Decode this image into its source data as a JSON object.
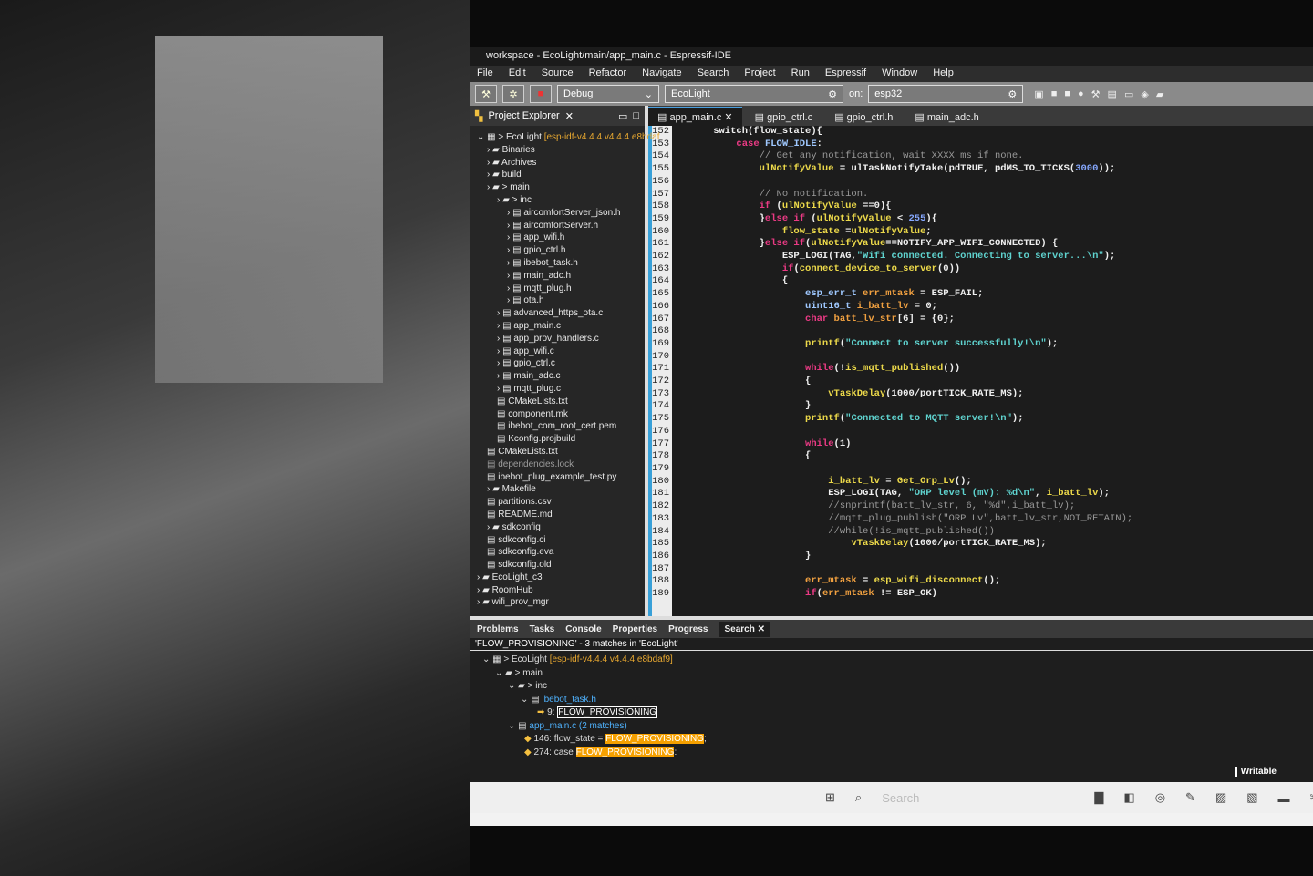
{
  "window": {
    "title": "workspace - EcoLight/main/app_main.c - Espressif-IDE"
  },
  "menu": [
    "File",
    "Edit",
    "Source",
    "Refactor",
    "Navigate",
    "Search",
    "Project",
    "Run",
    "Espressif",
    "Window",
    "Help"
  ],
  "toolbar": {
    "mode": "Debug",
    "project": "EcoLight",
    "on_label": "on:",
    "target": "esp32"
  },
  "explorer": {
    "title": "Project Explorer",
    "root": "> EcoLight",
    "root_version": "[esp-idf-v4.4.4 v4.4.4 e8bdaf",
    "items": [
      {
        "label": "Binaries",
        "indent": 1
      },
      {
        "label": "Archives",
        "indent": 1
      },
      {
        "label": "build",
        "indent": 1
      },
      {
        "label": "> main",
        "indent": 1
      },
      {
        "label": "> inc",
        "indent": 2
      },
      {
        "label": "aircomfortServer_json.h",
        "indent": 3
      },
      {
        "label": "aircomfortServer.h",
        "indent": 3
      },
      {
        "label": "app_wifi.h",
        "indent": 3
      },
      {
        "label": "gpio_ctrl.h",
        "indent": 3
      },
      {
        "label": "ibebot_task.h",
        "indent": 3
      },
      {
        "label": "main_adc.h",
        "indent": 3
      },
      {
        "label": "mqtt_plug.h",
        "indent": 3
      },
      {
        "label": "ota.h",
        "indent": 3
      },
      {
        "label": "advanced_https_ota.c",
        "indent": 2
      },
      {
        "label": "app_main.c",
        "indent": 2
      },
      {
        "label": "app_prov_handlers.c",
        "indent": 2
      },
      {
        "label": "app_wifi.c",
        "indent": 2
      },
      {
        "label": "gpio_ctrl.c",
        "indent": 2
      },
      {
        "label": "main_adc.c",
        "indent": 2
      },
      {
        "label": "mqtt_plug.c",
        "indent": 2
      },
      {
        "label": "CMakeLists.txt",
        "indent": 2
      },
      {
        "label": "component.mk",
        "indent": 2
      },
      {
        "label": "ibebot_com_root_cert.pem",
        "indent": 2
      },
      {
        "label": "Kconfig.projbuild",
        "indent": 2
      },
      {
        "label": "CMakeLists.txt",
        "indent": 1
      },
      {
        "label": "dependencies.lock",
        "indent": 1,
        "dim": true
      },
      {
        "label": "ibebot_plug_example_test.py",
        "indent": 1
      },
      {
        "label": "Makefile",
        "indent": 1
      },
      {
        "label": "partitions.csv",
        "indent": 1
      },
      {
        "label": "README.md",
        "indent": 1
      },
      {
        "label": "sdkconfig",
        "indent": 1
      },
      {
        "label": "sdkconfig.ci",
        "indent": 1
      },
      {
        "label": "sdkconfig.eva",
        "indent": 1
      },
      {
        "label": "sdkconfig.old",
        "indent": 1
      },
      {
        "label": "EcoLight_c3",
        "indent": 0
      },
      {
        "label": "RoomHub",
        "indent": 0
      },
      {
        "label": "wifi_prov_mgr",
        "indent": 0
      }
    ]
  },
  "editor": {
    "tabs": [
      "app_main.c",
      "gpio_ctrl.c",
      "gpio_ctrl.h",
      "main_adc.h"
    ],
    "active_tab": 0,
    "first_line": 152,
    "lines": [
      [
        [
          "    switch(flow_state){",
          "p"
        ]
      ],
      [
        [
          "        ",
          "p"
        ],
        [
          "case ",
          "k"
        ],
        [
          "FLOW_IDLE",
          "m"
        ],
        [
          ":",
          "p"
        ]
      ],
      [
        [
          "            // Get any notification, wait XXXX ms if none.",
          "c"
        ]
      ],
      [
        [
          "            ",
          "p"
        ],
        [
          "ulNotifyValue",
          "i"
        ],
        [
          " = ulTaskNotifyTake(pdTRUE, pdMS_TO_TICKS(",
          "p"
        ],
        [
          "3000",
          "n"
        ],
        [
          "));",
          "p"
        ]
      ],
      [
        [
          "",
          "p"
        ]
      ],
      [
        [
          "            // No notification.",
          "c"
        ]
      ],
      [
        [
          "            ",
          "p"
        ],
        [
          "if ",
          "k"
        ],
        [
          "(",
          "p"
        ],
        [
          "ulNotifyValue",
          "i"
        ],
        [
          " ==0){",
          "p"
        ]
      ],
      [
        [
          "            }",
          "p"
        ],
        [
          "else if ",
          "k"
        ],
        [
          "(",
          "p"
        ],
        [
          "ulNotifyValue",
          "i"
        ],
        [
          " < ",
          "p"
        ],
        [
          "255",
          "n"
        ],
        [
          "){",
          "p"
        ]
      ],
      [
        [
          "                ",
          "p"
        ],
        [
          "flow_state",
          "i"
        ],
        [
          " =",
          "p"
        ],
        [
          "ulNotifyValue",
          "i"
        ],
        [
          ";",
          "p"
        ]
      ],
      [
        [
          "            }",
          "p"
        ],
        [
          "else if",
          "k"
        ],
        [
          "(",
          "p"
        ],
        [
          "ulNotifyValue",
          "i"
        ],
        [
          "==NOTIFY_APP_WIFI_CONNECTED) {",
          "p"
        ]
      ],
      [
        [
          "                ESP_LOGI(TAG,",
          "p"
        ],
        [
          "\"Wifi connected. Connecting to server...\\n\"",
          "s"
        ],
        [
          ");",
          "p"
        ]
      ],
      [
        [
          "                ",
          "p"
        ],
        [
          "if",
          "k"
        ],
        [
          "(",
          "p"
        ],
        [
          "connect_device_to_server",
          "i"
        ],
        [
          "(0))",
          "p"
        ]
      ],
      [
        [
          "                {",
          "p"
        ]
      ],
      [
        [
          "                    ",
          "p"
        ],
        [
          "esp_err_t ",
          "m"
        ],
        [
          "err_mtask",
          "e"
        ],
        [
          " = ESP_FAIL;",
          "p"
        ]
      ],
      [
        [
          "                    ",
          "p"
        ],
        [
          "uint16_t ",
          "m"
        ],
        [
          "i_batt_lv",
          "e"
        ],
        [
          " = 0;",
          "p"
        ]
      ],
      [
        [
          "                    ",
          "p"
        ],
        [
          "char ",
          "k"
        ],
        [
          "batt_lv_str",
          "e"
        ],
        [
          "[6] = {0};",
          "p"
        ]
      ],
      [
        [
          "",
          "p"
        ]
      ],
      [
        [
          "                    ",
          "p"
        ],
        [
          "printf",
          "i"
        ],
        [
          "(",
          "p"
        ],
        [
          "\"Connect to server successfully!\\n\"",
          "s"
        ],
        [
          ");",
          "p"
        ]
      ],
      [
        [
          "",
          "p"
        ]
      ],
      [
        [
          "                    ",
          "p"
        ],
        [
          "while",
          "k"
        ],
        [
          "(!",
          "p"
        ],
        [
          "is_mqtt_published",
          "i"
        ],
        [
          "())",
          "p"
        ]
      ],
      [
        [
          "                    {",
          "p"
        ]
      ],
      [
        [
          "                        ",
          "p"
        ],
        [
          "vTaskDelay",
          "i"
        ],
        [
          "(1000/portTICK_RATE_MS);",
          "p"
        ]
      ],
      [
        [
          "                    }",
          "p"
        ]
      ],
      [
        [
          "                    ",
          "p"
        ],
        [
          "printf",
          "i"
        ],
        [
          "(",
          "p"
        ],
        [
          "\"Connected to MQTT server!\\n\"",
          "s"
        ],
        [
          ");",
          "p"
        ]
      ],
      [
        [
          "",
          "p"
        ]
      ],
      [
        [
          "                    ",
          "p"
        ],
        [
          "while",
          "k"
        ],
        [
          "(1)",
          "p"
        ]
      ],
      [
        [
          "                    {",
          "p"
        ]
      ],
      [
        [
          "",
          "p"
        ]
      ],
      [
        [
          "                        ",
          "p"
        ],
        [
          "i_batt_lv",
          "i"
        ],
        [
          " = ",
          "p"
        ],
        [
          "Get_Orp_Lv",
          "i"
        ],
        [
          "();",
          "p"
        ]
      ],
      [
        [
          "                        ESP_LOGI(TAG, ",
          "p"
        ],
        [
          "\"ORP level (mV): %d\\n\"",
          "s"
        ],
        [
          ", ",
          "p"
        ],
        [
          "i_batt_lv",
          "i"
        ],
        [
          ");",
          "p"
        ]
      ],
      [
        [
          "                        //snprintf(batt_lv_str, 6, \"%d\",i_batt_lv);",
          "c"
        ]
      ],
      [
        [
          "                        //mqtt_plug_publish(\"ORP Lv\",batt_lv_str,NOT_RETAIN);",
          "c"
        ]
      ],
      [
        [
          "                        //while(!is_mqtt_published())",
          "c"
        ]
      ],
      [
        [
          "                            ",
          "p"
        ],
        [
          "vTaskDelay",
          "i"
        ],
        [
          "(1000/portTICK_RATE_MS);",
          "p"
        ]
      ],
      [
        [
          "                    }",
          "p"
        ]
      ],
      [
        [
          "",
          "p"
        ]
      ],
      [
        [
          "                    ",
          "p"
        ],
        [
          "err_mtask",
          "e"
        ],
        [
          " = ",
          "p"
        ],
        [
          "esp_wifi_disconnect",
          "i"
        ],
        [
          "();",
          "p"
        ]
      ],
      [
        [
          "                    ",
          "p"
        ],
        [
          "if",
          "k"
        ],
        [
          "(",
          "p"
        ],
        [
          "err_mtask",
          "e"
        ],
        [
          " != ESP_OK)",
          "p"
        ]
      ]
    ]
  },
  "bottom": {
    "tabs": [
      "Problems",
      "Tasks",
      "Console",
      "Properties",
      "Progress",
      "Search"
    ],
    "active_tab": 5,
    "summary": "'FLOW_PROVISIONING' - 3 matches in 'EcoLight'",
    "root": "> EcoLight",
    "root_version": "[esp-idf-v4.4.4 v4.4.4 e8bdaf9]",
    "main": "> main",
    "inc": "> inc",
    "file1": "ibebot_task.h",
    "m1_prefix": "9: ",
    "m1": "FLOW_PROVISIONING",
    "file2": "app_main.c",
    "file2_count": "(2 matches)",
    "m2_prefix": "146: flow_state = ",
    "m2": "FLOW_PROVISIONING",
    "m2_suffix": ";",
    "m3_prefix": "274: case ",
    "m3": "FLOW_PROVISIONING",
    "m3_suffix": ":"
  },
  "status": {
    "mode": "Writable"
  },
  "taskbar": {
    "search_placeholder": "Search"
  },
  "colors": {
    "keyword": "#ea3a84",
    "identifier": "#ecd94a",
    "string": "#5fd3cf",
    "comment": "#9a9a9a",
    "match_highlight": "#f5a000"
  }
}
